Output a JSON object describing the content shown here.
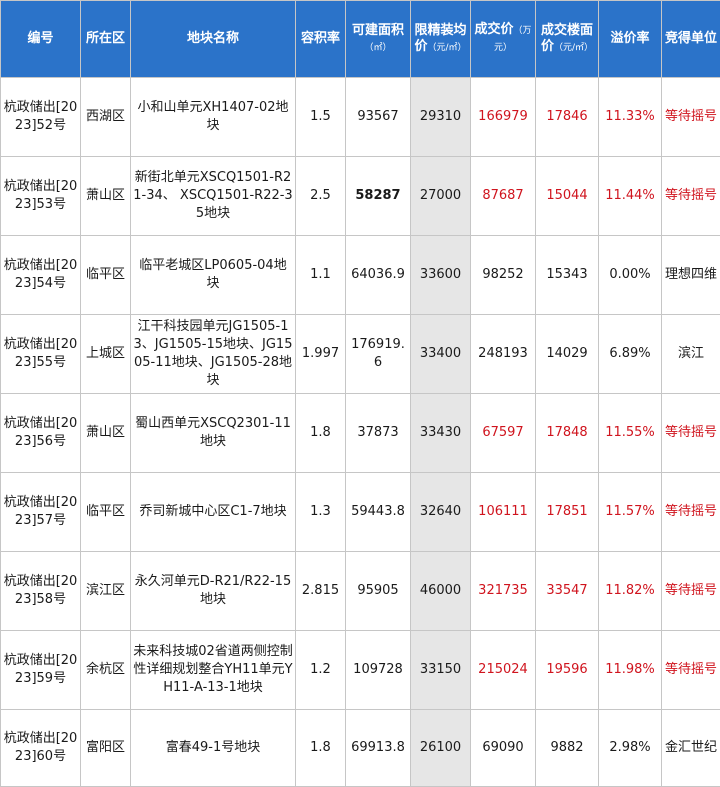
{
  "headers": {
    "code": "编号",
    "district": "所在区",
    "plot_name": "地块名称",
    "plot_ratio": "容积率",
    "buildable_area": "可建面积",
    "buildable_area_unit": "（㎡）",
    "price_limit": "限精装均价",
    "price_limit_unit": "（元/㎡）",
    "deal_price": "成交价",
    "deal_price_unit": "（万元）",
    "floor_price": "成交楼面价",
    "floor_price_unit": "（元/㎡）",
    "premium": "溢价率",
    "winner": "竞得单位"
  },
  "rows": [
    {
      "code": "杭政储出[2023]52号",
      "district": "西湖区",
      "name": "小和山单元XH1407-02地块",
      "ratio": "1.5",
      "area": "93567",
      "limit": "29310",
      "deal": "166979",
      "floor": "17846",
      "premium": "11.33%",
      "winner": "等待摇号",
      "highlight": true,
      "bold_area": false
    },
    {
      "code": "杭政储出[2023]53号",
      "district": "萧山区",
      "name": "新街北单元XSCQ1501-R21-34、 XSCQ1501-R22-35地块",
      "ratio": "2.5",
      "area": "58287",
      "limit": "27000",
      "deal": "87687",
      "floor": "15044",
      "premium": "11.44%",
      "winner": "等待摇号",
      "highlight": true,
      "bold_area": true
    },
    {
      "code": "杭政储出[2023]54号",
      "district": "临平区",
      "name": "临平老城区LP0605-04地块",
      "ratio": "1.1",
      "area": "64036.9",
      "limit": "33600",
      "deal": "98252",
      "floor": "15343",
      "premium": "0.00%",
      "winner": "理想四维",
      "highlight": false,
      "bold_area": false
    },
    {
      "code": "杭政储出[2023]55号",
      "district": "上城区",
      "name": "江干科技园单元JG1505-13、JG1505-15地块、JG1505-11地块、JG1505-28地块",
      "ratio": "1.997",
      "area": "176919.6",
      "limit": "33400",
      "deal": "248193",
      "floor": "14029",
      "premium": "6.89%",
      "winner": "滨江",
      "highlight": false,
      "bold_area": false
    },
    {
      "code": "杭政储出[2023]56号",
      "district": "萧山区",
      "name": "蜀山西单元XSCQ2301-11地块",
      "ratio": "1.8",
      "area": "37873",
      "limit": "33430",
      "deal": "67597",
      "floor": "17848",
      "premium": "11.55%",
      "winner": "等待摇号",
      "highlight": true,
      "bold_area": false
    },
    {
      "code": "杭政储出[2023]57号",
      "district": "临平区",
      "name": "乔司新城中心区C1-7地块",
      "ratio": "1.3",
      "area": "59443.8",
      "limit": "32640",
      "deal": "106111",
      "floor": "17851",
      "premium": "11.57%",
      "winner": "等待摇号",
      "highlight": true,
      "bold_area": false
    },
    {
      "code": "杭政储出[2023]58号",
      "district": "滨江区",
      "name": "永久河单元D-R21/R22-15地块",
      "ratio": "2.815",
      "area": "95905",
      "limit": "46000",
      "deal": "321735",
      "floor": "33547",
      "premium": "11.82%",
      "winner": "等待摇号",
      "highlight": true,
      "bold_area": false
    },
    {
      "code": "杭政储出[2023]59号",
      "district": "余杭区",
      "name": "未来科技城02省道两侧控制性详细规划整合YH11单元YH11-A-13-1地块",
      "ratio": "1.2",
      "area": "109728",
      "limit": "33150",
      "deal": "215024",
      "floor": "19596",
      "premium": "11.98%",
      "winner": "等待摇号",
      "highlight": true,
      "bold_area": false
    },
    {
      "code": "杭政储出[2023]60号",
      "district": "富阳区",
      "name": "富春49-1号地块",
      "ratio": "1.8",
      "area": "69913.8",
      "limit": "26100",
      "deal": "69090",
      "floor": "9882",
      "premium": "2.98%",
      "winner": "金汇世纪",
      "highlight": false,
      "bold_area": false
    }
  ]
}
